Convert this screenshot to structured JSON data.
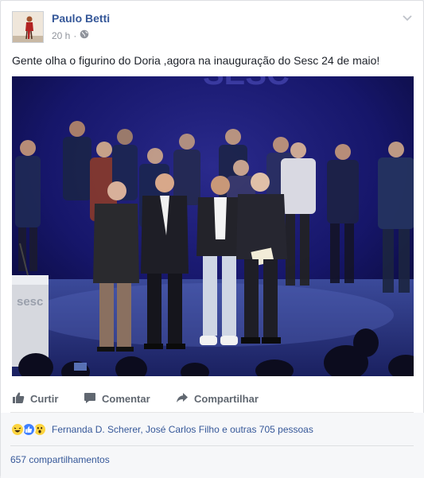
{
  "post": {
    "author": "Paulo Betti",
    "time": "20 h",
    "privacy_icon": "globe-icon",
    "text": "Gente olha o figurino do Doria ,agora na inauguração do Sesc 24 de maio!",
    "photo": {
      "stage_sign": "SESC",
      "podium_logo": "sesc"
    }
  },
  "actions": {
    "like_label": "Curtir",
    "comment_label": "Comentar",
    "share_label": "Compartilhar"
  },
  "reactions": {
    "icons": [
      "haha-icon",
      "like-icon",
      "wow-icon"
    ],
    "summary": "Fernanda D. Scherer, José Carlos Filho e outras 705 pessoas"
  },
  "shares": {
    "count_label": "657 compartilhamentos"
  },
  "colors": {
    "link": "#365899",
    "muted": "#90949c",
    "action_text": "#606770",
    "like_blue": "#4080ff",
    "reaction_yellow": "#fcd440"
  }
}
